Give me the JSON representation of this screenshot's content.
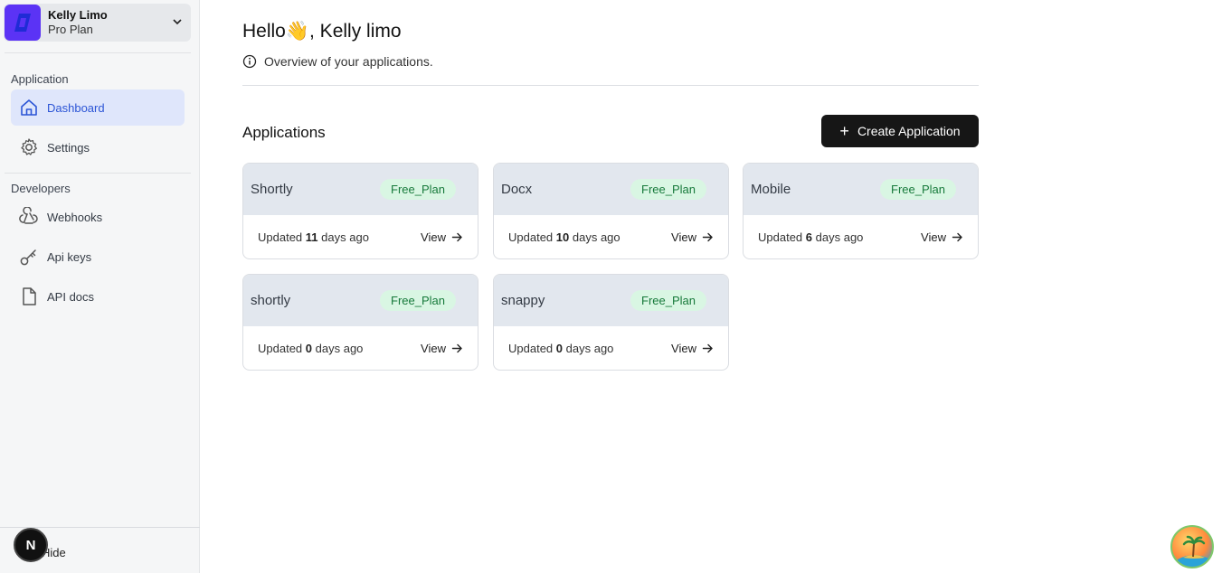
{
  "account": {
    "name": "Kelly Limo",
    "plan": "Pro Plan"
  },
  "sidebar": {
    "sections": [
      {
        "label": "Application"
      },
      {
        "label": "Developers"
      }
    ],
    "items": [
      {
        "label": "Dashboard",
        "icon": "home-icon",
        "active": true
      },
      {
        "label": "Settings",
        "icon": "gear-icon"
      },
      {
        "label": "Webhooks",
        "icon": "webhook-icon"
      },
      {
        "label": "Api keys",
        "icon": "key-icon"
      },
      {
        "label": "API docs",
        "icon": "document-icon"
      }
    ],
    "hide_label": "Hide",
    "n_badge": "N"
  },
  "header": {
    "hello": "Hello",
    "wave": "👋",
    "name_part": ", Kelly limo",
    "overview": "Overview of your applications."
  },
  "apps": {
    "title": "Applications",
    "create_label": "Create Application",
    "updated_prefix": "Updated",
    "days_suffix": "days ago",
    "view_label": "View",
    "list": [
      {
        "name": "Shortly",
        "plan": "Free_Plan",
        "days": "11"
      },
      {
        "name": "Docx",
        "plan": "Free_Plan",
        "days": "10"
      },
      {
        "name": "Mobile",
        "plan": "Free_Plan",
        "days": "6"
      },
      {
        "name": "shortly",
        "plan": "Free_Plan",
        "days": "0"
      },
      {
        "name": "snappy",
        "plan": "Free_Plan",
        "days": "0"
      }
    ]
  }
}
